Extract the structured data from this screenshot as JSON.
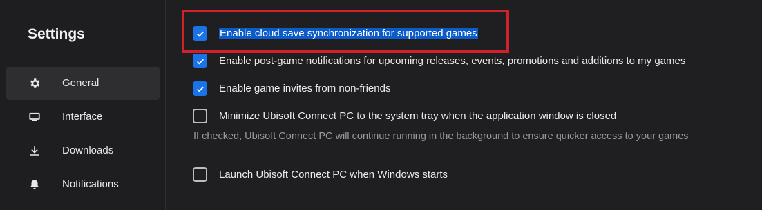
{
  "sidebar": {
    "title": "Settings",
    "items": [
      {
        "label": "General",
        "icon": "gear-icon",
        "active": true
      },
      {
        "label": "Interface",
        "icon": "monitor-icon",
        "active": false
      },
      {
        "label": "Downloads",
        "icon": "download-icon",
        "active": false
      },
      {
        "label": "Notifications",
        "icon": "bell-icon",
        "active": false
      }
    ]
  },
  "options": [
    {
      "label": "Enable cloud save synchronization for supported games",
      "checked": true,
      "text_selected": true
    },
    {
      "label": "Enable post-game notifications for upcoming releases, events, promotions and additions to my games",
      "checked": true
    },
    {
      "label": "Enable game invites from non-friends",
      "checked": true
    },
    {
      "label": "Minimize Ubisoft Connect PC to the system tray when the application window is closed",
      "checked": false
    },
    {
      "label": "Launch Ubisoft Connect PC when Windows starts",
      "checked": false
    }
  ],
  "help_text": "If checked, Ubisoft Connect PC will continue running in the background to ensure quicker access to your games",
  "colors": {
    "accent": "#1a73e8",
    "annotation": "#d0202a",
    "background": "#1f1f21"
  }
}
